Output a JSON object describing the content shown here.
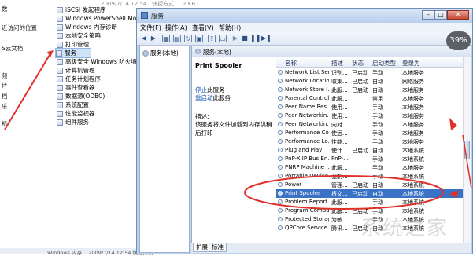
{
  "left_strip": {
    "items": [
      "数",
      "近访问的位置",
      "S云文档",
      "频",
      "片",
      "档",
      "乐",
      "机"
    ]
  },
  "tree": {
    "top_meta": [
      "2009/7/14 12:54",
      "快捷方式",
      "2 KB"
    ],
    "items": [
      {
        "label": "iSCSI 发起程序"
      },
      {
        "label": "Windows PowerShell Modules"
      },
      {
        "label": "Windows 内存诊断"
      },
      {
        "label": "本地安全策略"
      },
      {
        "label": "打印管理"
      },
      {
        "label": "服务",
        "selected": true
      },
      {
        "label": "高级安全 Windows 防火墙"
      },
      {
        "label": "计算机管理"
      },
      {
        "label": "任务计划程序"
      },
      {
        "label": "事件查看器"
      },
      {
        "label": "数据源(ODBC)"
      },
      {
        "label": "系统配置"
      },
      {
        "label": "性能监视器"
      },
      {
        "label": "组件服务"
      }
    ],
    "bottom_meta": "Windows 内存... 2009/7/14 12:54 快捷方式"
  },
  "window": {
    "title": "服务",
    "menu": [
      "文件(F)",
      "操作(A)",
      "查看(V)",
      "帮助(H)"
    ],
    "nav_item": "服务(本地)",
    "header": "服务(本地)",
    "selected_title": "Print Spooler",
    "link_stop_prefix": "停止",
    "link_stop_text": "此服务",
    "link_restart_prefix": "重启动",
    "link_restart_text": "此服务",
    "desc_label": "描述:",
    "desc_text": "该服务将文件加载到内存供稍后打印",
    "columns": {
      "name": "名称",
      "desc": "描述",
      "status": "状态",
      "startup": "启动类型",
      "logon": "登录为"
    },
    "services": [
      {
        "name": "Network List Ser...",
        "desc": "识别...",
        "status": "已启动",
        "startup": "手动",
        "logon": "本地服务"
      },
      {
        "name": "Network Locatio...",
        "desc": "收集...",
        "status": "已启动",
        "startup": "自动",
        "logon": "网络服务"
      },
      {
        "name": "Network Store I...",
        "desc": "此服...",
        "status": "已启动",
        "startup": "自动",
        "logon": "本地服务"
      },
      {
        "name": "Parental Controls",
        "desc": "此服...",
        "status": "",
        "startup": "禁用",
        "logon": "本地服务"
      },
      {
        "name": "Peer Name Res...",
        "desc": "使用...",
        "status": "",
        "startup": "手动",
        "logon": "本地服务"
      },
      {
        "name": "Peer Networkin...",
        "desc": "使用...",
        "status": "",
        "startup": "手动",
        "logon": "本地服务"
      },
      {
        "name": "Peer Networkin...",
        "desc": "向对...",
        "status": "",
        "startup": "手动",
        "logon": "本地服务"
      },
      {
        "name": "Performance Co...",
        "desc": "使远...",
        "status": "",
        "startup": "手动",
        "logon": "本地服务"
      },
      {
        "name": "Performance Lo...",
        "desc": "性能...",
        "status": "",
        "startup": "手动",
        "logon": "本地服务"
      },
      {
        "name": "Plug and Play",
        "desc": "使计...",
        "status": "已启动",
        "startup": "自动",
        "logon": "本地系统"
      },
      {
        "name": "PnP-X IP Bus En...",
        "desc": "PnP-...",
        "status": "",
        "startup": "手动",
        "logon": "本地系统"
      },
      {
        "name": "PNRP Machine ...",
        "desc": "此服...",
        "status": "",
        "startup": "手动",
        "logon": "本地服务"
      },
      {
        "name": "Portable Device ...",
        "desc": "强制...",
        "status": "",
        "startup": "手动",
        "logon": "本地系统"
      },
      {
        "name": "Power",
        "desc": "管理...",
        "status": "已启动",
        "startup": "自动",
        "logon": "本地系统"
      },
      {
        "name": "Print Spooler",
        "desc": "将文...",
        "status": "已启动",
        "startup": "自动",
        "logon": "本地系统",
        "selected": true
      },
      {
        "name": "Problem Report...",
        "desc": "此服...",
        "status": "",
        "startup": "手动",
        "logon": "本地系统"
      },
      {
        "name": "Program Compa...",
        "desc": "此服...",
        "status": "已启动",
        "startup": "手动",
        "logon": "本地系统"
      },
      {
        "name": "Protected Storage",
        "desc": "为敏...",
        "status": "",
        "startup": "手动",
        "logon": "本地系统"
      },
      {
        "name": "QPCore Service",
        "desc": "腾讯...",
        "status": "已启动",
        "startup": "自动",
        "logon": "本地系统"
      }
    ],
    "tabs": [
      "扩展",
      "标准"
    ]
  },
  "zoom_badge": "39%",
  "watermark": "系统之家",
  "colors": {
    "selection": "#3a73c6",
    "annotation": "#e0302a"
  }
}
